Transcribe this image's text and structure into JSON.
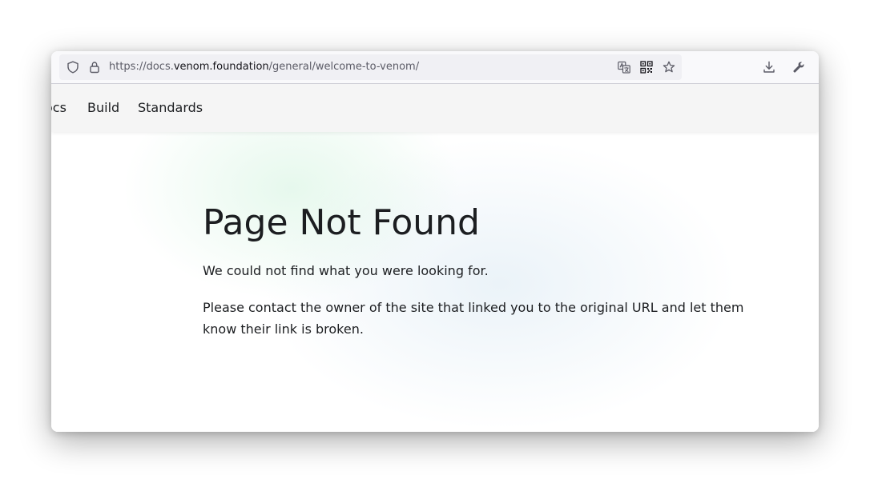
{
  "browser": {
    "url": {
      "scheme": "https://docs.",
      "domain": "venom.foundation",
      "path": "/general/welcome-to-venom/"
    },
    "icons": {
      "tracking_protection": "shield-icon",
      "connection": "lock-icon",
      "translate": "translate-icon",
      "qr_code": "qr-code-icon",
      "bookmark": "star-icon",
      "downloads": "download-icon",
      "tools": "wrench-icon"
    }
  },
  "site_nav": {
    "links": [
      "ocs",
      "Build",
      "Standards"
    ]
  },
  "main": {
    "title": "Page Not Found",
    "paragraphs": [
      "We could not find what you were looking for.",
      "Please contact the owner of the site that linked you to the original URL and let them know their link is broken."
    ]
  },
  "colors": {
    "text": "#1c1e21",
    "nav_background": "#f5f5f5",
    "url_muted": "#5b5b66"
  }
}
